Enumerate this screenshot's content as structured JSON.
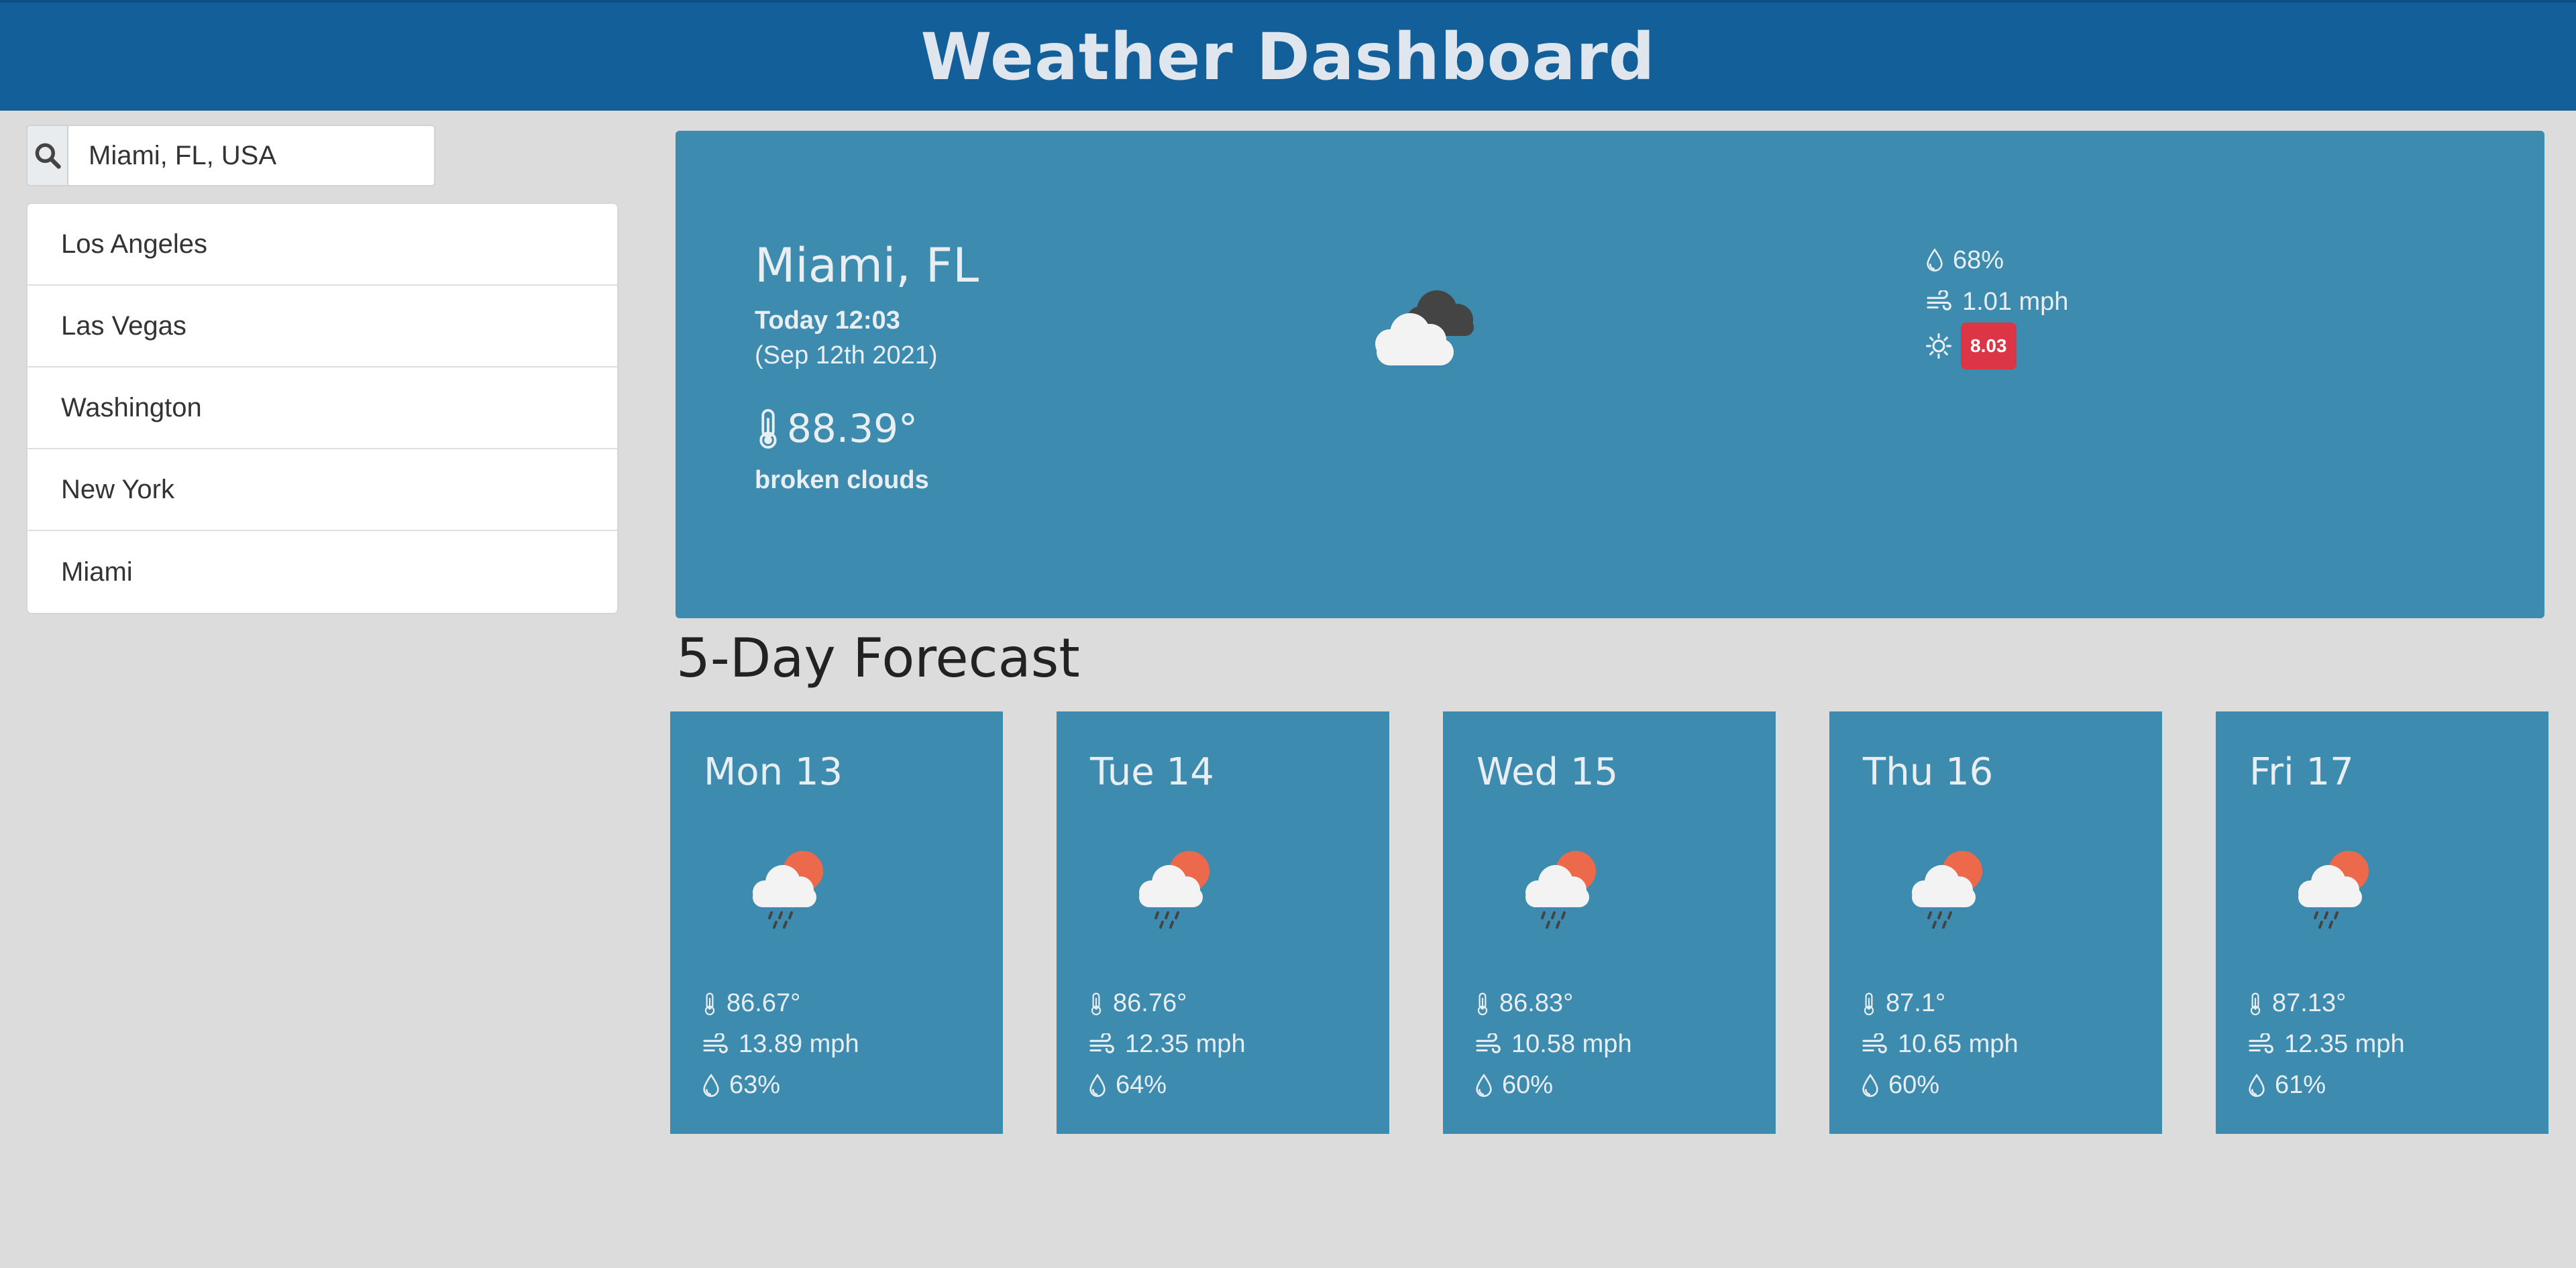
{
  "header": {
    "title": "Weather Dashboard"
  },
  "search": {
    "value": "Miami, FL, USA",
    "icon": "search-icon"
  },
  "history": [
    {
      "label": "Los Angeles"
    },
    {
      "label": "Las Vegas"
    },
    {
      "label": "Washington"
    },
    {
      "label": "New York"
    },
    {
      "label": "Miami"
    }
  ],
  "current": {
    "city": "Miami, FL",
    "today": "Today 12:03",
    "date": "(Sep 12th 2021)",
    "temp": "88.39°",
    "description": "broken clouds",
    "icon": "broken-clouds-icon",
    "humidity": "68%",
    "wind": "1.01 mph",
    "uv": "8.03",
    "uv_color": "#dc3545"
  },
  "forecast": {
    "title": "5-Day Forecast",
    "days": [
      {
        "day": "Mon 13",
        "temp": "86.67°",
        "wind": "13.89 mph",
        "humidity": "63%",
        "icon": "rain-sun-icon"
      },
      {
        "day": "Tue 14",
        "temp": "86.76°",
        "wind": "12.35 mph",
        "humidity": "64%",
        "icon": "rain-sun-icon"
      },
      {
        "day": "Wed 15",
        "temp": "86.83°",
        "wind": "10.58 mph",
        "humidity": "60%",
        "icon": "rain-sun-icon"
      },
      {
        "day": "Thu 16",
        "temp": "87.1°",
        "wind": "10.65 mph",
        "humidity": "60%",
        "icon": "rain-sun-icon"
      },
      {
        "day": "Fri 17",
        "temp": "87.13°",
        "wind": "12.35 mph",
        "humidity": "61%",
        "icon": "rain-sun-icon"
      }
    ]
  },
  "colors": {
    "header": "#125f9a",
    "card": "#3d8bae",
    "background": "#dcdcdc",
    "uv_badge": "#dc3545"
  }
}
